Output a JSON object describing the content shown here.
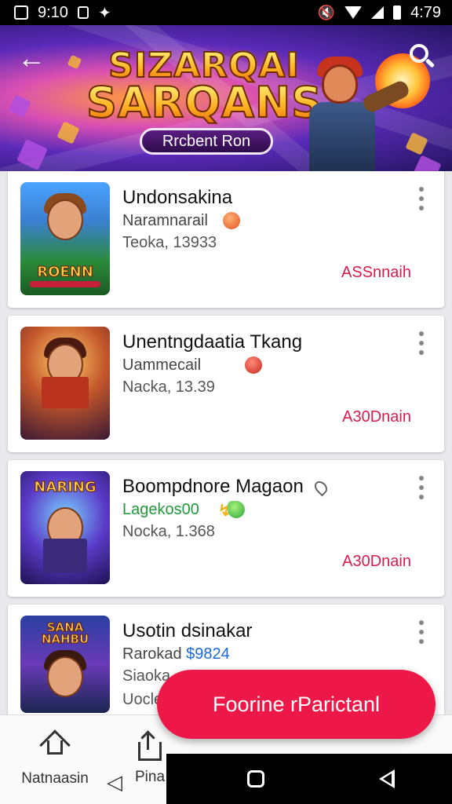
{
  "status_bar": {
    "time_left": "9:10",
    "time_right": "4:79"
  },
  "banner": {
    "logo_line1": "SIZARQAI",
    "logo_line2": "SARQANS",
    "pill_label": "Rrcbent Ron",
    "back_icon": "arrow-left-icon",
    "search_icon": "search-icon"
  },
  "games": [
    {
      "title": "Undonsakina",
      "subtitle": "Naramnarail",
      "meta": "Teoka, 13933",
      "action": "ASSnnaih",
      "thumb_label": "ROENN",
      "badge": "orange"
    },
    {
      "title": "Unentngdaatia Tkang",
      "subtitle": "Uammecail",
      "meta": "Nacka, 13.39",
      "action": "A30Dnain",
      "badge": "red"
    },
    {
      "title": "Boompdnore Magaon",
      "subtitle": "Lagekos00",
      "meta": "Nocka, 1.368",
      "action": "A30Dnain",
      "thumb_label": "NARING",
      "badge": "green"
    },
    {
      "title": "Usotin dsinakar",
      "subtitle_prefix": "Rarokad",
      "subtitle_link": "$9824",
      "meta": "Siaoka",
      "meta2": "Uocle",
      "thumb_label": "SANA NAHBU"
    }
  ],
  "fab": {
    "label": "Foorine rParictanl"
  },
  "bottom_nav": {
    "home_label": "Natnaasin",
    "second_label": "Pina"
  },
  "colors": {
    "accent": "#ee1848",
    "action_text": "#d81b4a",
    "green_text": "#1f9a3a"
  }
}
